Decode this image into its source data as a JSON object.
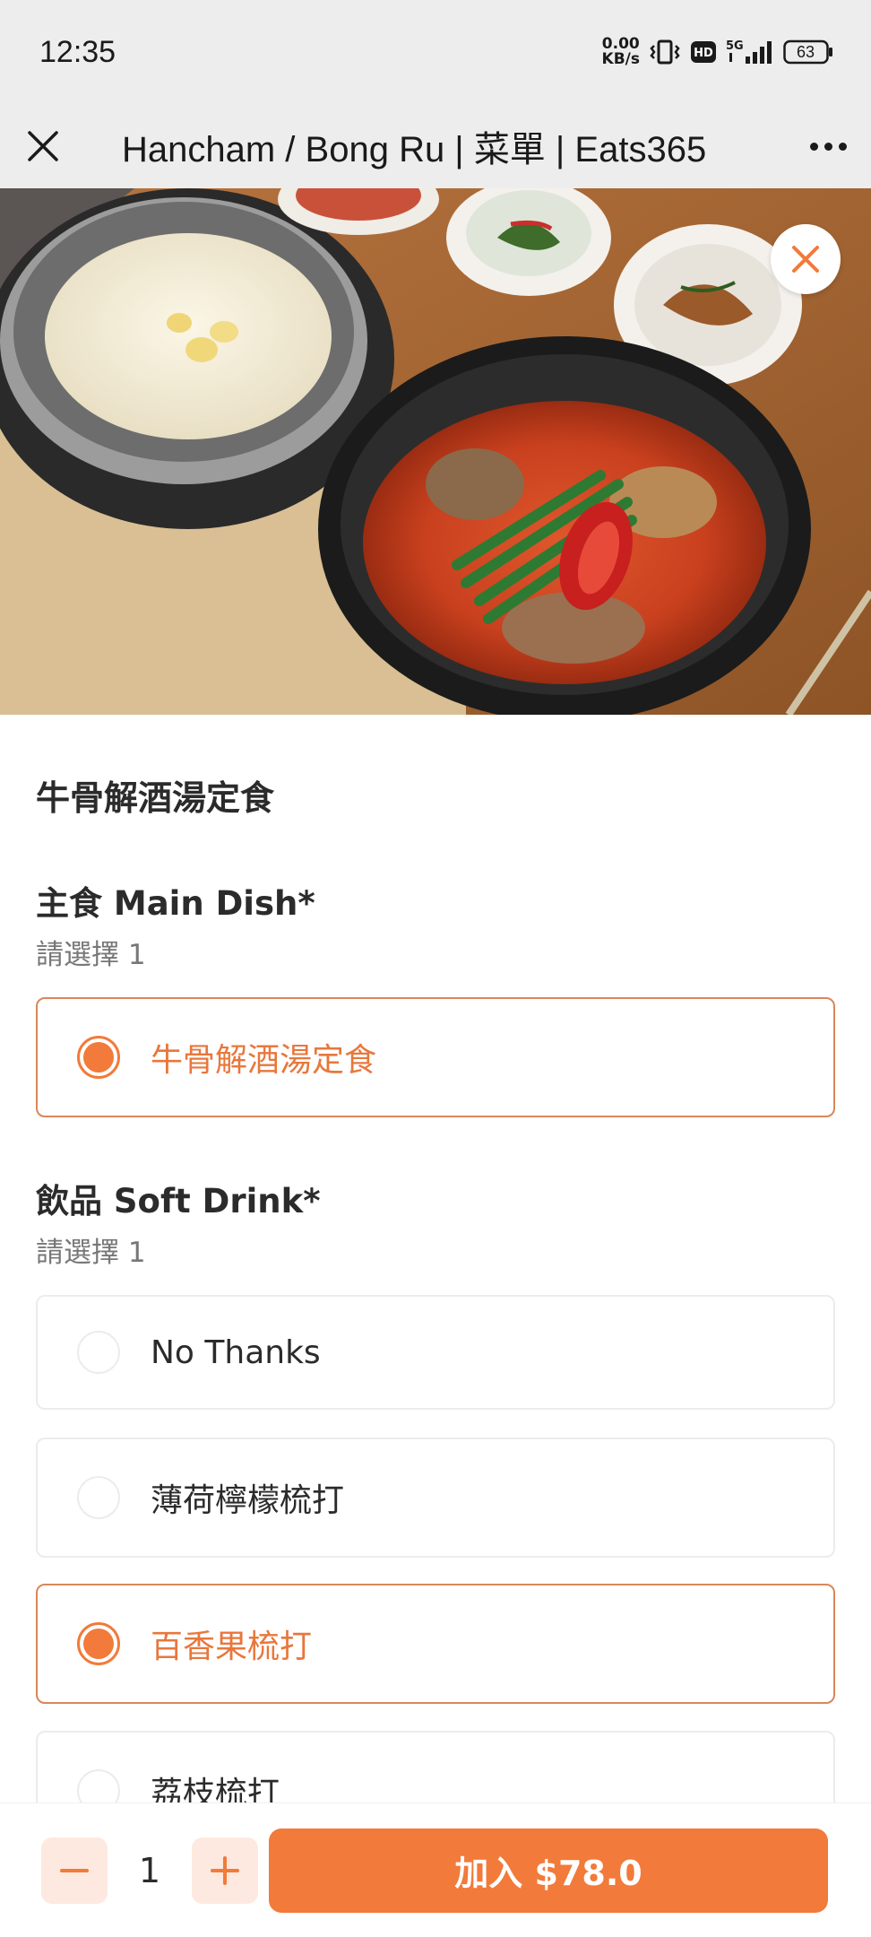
{
  "status_bar": {
    "time": "12:35",
    "net_speed_value": "0.00",
    "net_speed_unit": "KB/s",
    "hd_label": "HD",
    "network": "5G",
    "battery": "63"
  },
  "title_bar": {
    "title": "Hancham / Bong Ru | 菜單 | Eats365",
    "close_icon": "close-icon",
    "more_icon": "more-icon"
  },
  "hero": {
    "image": "korean-soup-set-meal-photo",
    "close_icon": "close-icon"
  },
  "item": {
    "title": "牛骨解酒湯定食"
  },
  "groups": [
    {
      "title": "主食 Main Dish*",
      "subtitle": "請選擇 1",
      "options": [
        {
          "label": "牛骨解酒湯定食",
          "selected": true
        }
      ]
    },
    {
      "title": "飲品 Soft Drink*",
      "subtitle": "請選擇 1",
      "options": [
        {
          "label": "No Thanks",
          "selected": false
        },
        {
          "label": "薄荷檸檬梳打",
          "selected": false
        },
        {
          "label": "百香果梳打",
          "selected": true
        },
        {
          "label": "荔枝梳打",
          "selected": false
        }
      ]
    }
  ],
  "footer": {
    "quantity": "1",
    "add_button_label": "加入 $78.0"
  },
  "colors": {
    "accent": "#f27a3a",
    "accent_light": "#fde9df",
    "selected_border": "#d9875a",
    "header_bg": "#ededed"
  }
}
